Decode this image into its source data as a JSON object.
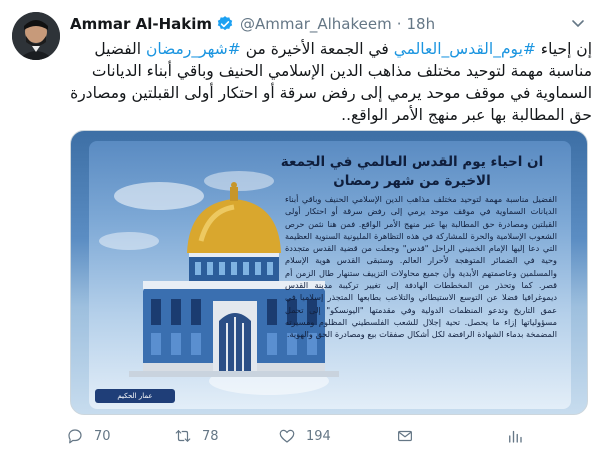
{
  "tweet": {
    "author_name": "Ammar Al-Hakim",
    "author_handle": "@Ammar_Alhakeem",
    "separator": "·",
    "time": "18h",
    "text_before": "إن إحياء ",
    "hashtag_1": "#يوم_القدس_العالمي",
    "text_mid_1": " في الجمعة الأخيرة من ",
    "hashtag_2": "#شهر_رمضان",
    "text_after": " الفضيل مناسبة مهمة لتوحيد مختلف مذاهب الدين الإسلامي الحنيف وباقي أبناء الديانات السماوية في موقف موحد يرمي إلى رفض سرقة أو احتكار أولى القبلتين ومصادرة حق المطالبة بها عبر منهج الأمر الواقع.."
  },
  "media_card": {
    "title": "ان احياء يوم القدس العالمي في الجمعة الاخيرة من شهر رمضان",
    "body": "الفضيل مناسبة مهمة لتوحيد مختلف مذاهب الدين الإسلامي الحنيف وباقي أبناء الديانات السماوية في موقف موحد يرمي إلى رفض سرقة أو احتكار أولى القبلتين ومصادرة حق المطالبة بها عبر منهج الأمر الواقع. فمن هنا نثمن حرص الشعوب الإسلامية والحرة للمشاركة في هذه التظاهرة المليونية السنوية العظيمة التي دعا إليها الإمام الخميني الراحل \"قدس\" وجعلت من قضية القدس متجددة وحية في الضمائر المتوهجة لأحرار العالم. وستبقى القدس هوية الإسلام والمسلمين وعاصمتهم الأبدية وأن جميع محاولات التزييف ستنهار طال الزمن أم قصر. كما وتحذر من المخططات الهادفة إلى تغيير تركيبة مدينة القدس ديموغرافيا فضلا عن التوسع الاستيطاني والتلاعب بطابعها المتجذر إسلاميا في عمق التاريخ وتدعو المنظمات الدولية وفي مقدمتها \"اليونسكو\" إلى تحمل مسؤولياتها إزاء ما يحصل. تحية إجلال للشعب الفلسطيني المظلوم ومسيرته المضمخة بدماء الشهادة الرافضة لكل أشكال صفقات بيع ومصادرة الحق والهوية.",
    "logo_text": "عمار الحكيم"
  },
  "actions": {
    "reply_count": "70",
    "retweet_count": "78",
    "like_count": "194"
  },
  "colors": {
    "link": "#1b95e0",
    "muted": "#657786",
    "verified": "#1da1f2"
  }
}
